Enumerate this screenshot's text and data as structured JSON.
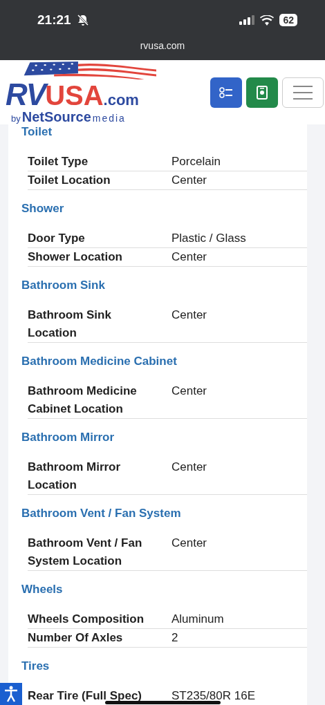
{
  "status_bar": {
    "time": "21:21",
    "battery": "62"
  },
  "browser": {
    "url": "rvusa.com"
  },
  "header": {
    "logo": {
      "main": "RV",
      "accent": "USA",
      "suffix": ".com",
      "by": "by",
      "brand": "NetSource",
      "brand_suffix": "media"
    }
  },
  "sections": [
    {
      "title": "Toilet",
      "rows": [
        {
          "label": "Toilet Type",
          "value": "Porcelain"
        },
        {
          "label": "Toilet Location",
          "value": "Center"
        }
      ]
    },
    {
      "title": "Shower",
      "rows": [
        {
          "label": "Door Type",
          "value": "Plastic / Glass"
        },
        {
          "label": "Shower Location",
          "value": "Center"
        }
      ]
    },
    {
      "title": "Bathroom Sink",
      "rows": [
        {
          "label": "Bathroom Sink Location",
          "value": "Center"
        }
      ]
    },
    {
      "title": "Bathroom Medicine Cabinet",
      "rows": [
        {
          "label": "Bathroom Medicine Cabinet Location",
          "value": "Center"
        }
      ]
    },
    {
      "title": "Bathroom Mirror",
      "rows": [
        {
          "label": "Bathroom Mirror Location",
          "value": "Center"
        }
      ]
    },
    {
      "title": "Bathroom Vent / Fan System",
      "rows": [
        {
          "label": "Bathroom Vent / Fan System Location",
          "value": "Center"
        }
      ]
    },
    {
      "title": "Wheels",
      "rows": [
        {
          "label": "Wheels Composition",
          "value": "Aluminum"
        },
        {
          "label": "Number Of Axles",
          "value": "2"
        }
      ]
    },
    {
      "title": "Tires",
      "rows": [
        {
          "label": "Rear Tire (Full Spec)",
          "value": "ST235/80R 16E"
        }
      ]
    }
  ]
}
